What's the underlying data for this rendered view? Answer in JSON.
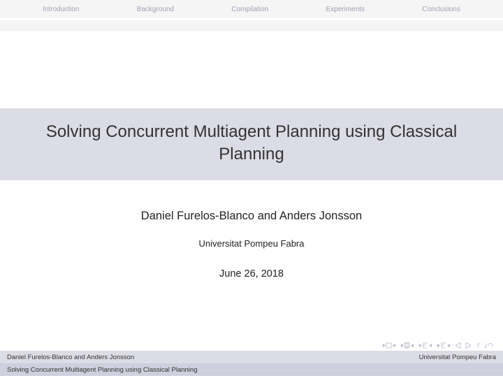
{
  "nav": {
    "items": [
      "Introduction",
      "Background",
      "Compilation",
      "Experiments",
      "Conclusions"
    ]
  },
  "title": "Solving Concurrent Multiagent Planning using Classical Planning",
  "authors": "Daniel Furelos-Blanco and Anders Jonsson",
  "affiliation": "Universitat Pompeu Fabra",
  "date": "June 26, 2018",
  "footer": {
    "left": "Daniel Furelos-Blanco and Anders Jonsson",
    "right": "Universitat Pompeu Fabra",
    "title": "Solving Concurrent Multiagent Planning using Classical Planning"
  }
}
